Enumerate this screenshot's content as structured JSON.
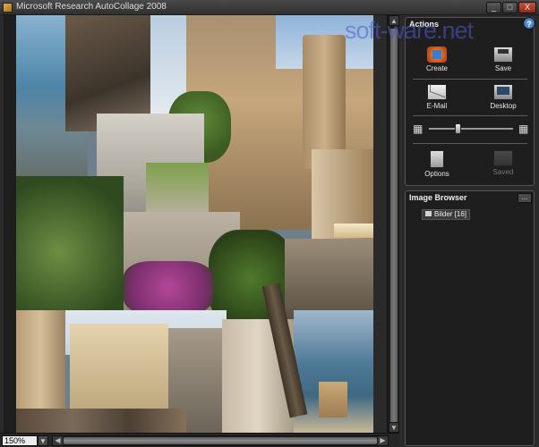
{
  "window": {
    "title": "Microsoft Research AutoCollage 2008",
    "buttons": {
      "minimize": "_",
      "maximize": "□",
      "close": "X"
    }
  },
  "statusbar": {
    "zoom_value": "150%",
    "zoom_dropdown_icon": "chevron-down-icon"
  },
  "actions_panel": {
    "title": "Actions",
    "help_label": "?",
    "items": [
      {
        "label": "Create",
        "icon": "create-collage-icon"
      },
      {
        "label": "Save",
        "icon": "save-icon"
      },
      {
        "label": "E-Mail",
        "icon": "email-icon"
      },
      {
        "label": "Desktop",
        "icon": "desktop-icon"
      },
      {
        "label": "Options",
        "icon": "options-icon"
      },
      {
        "label": "Saved",
        "icon": "saved-icon",
        "disabled": true
      }
    ],
    "size_slider": {
      "value": 0.33,
      "min_icon": "small-grid-icon",
      "max_icon": "large-grid-icon"
    }
  },
  "image_browser": {
    "title": "Image Browser",
    "more_label": "...",
    "folders": [
      {
        "name": "Bilder",
        "count": "[16]"
      }
    ]
  },
  "watermark": "soft-ware.net"
}
